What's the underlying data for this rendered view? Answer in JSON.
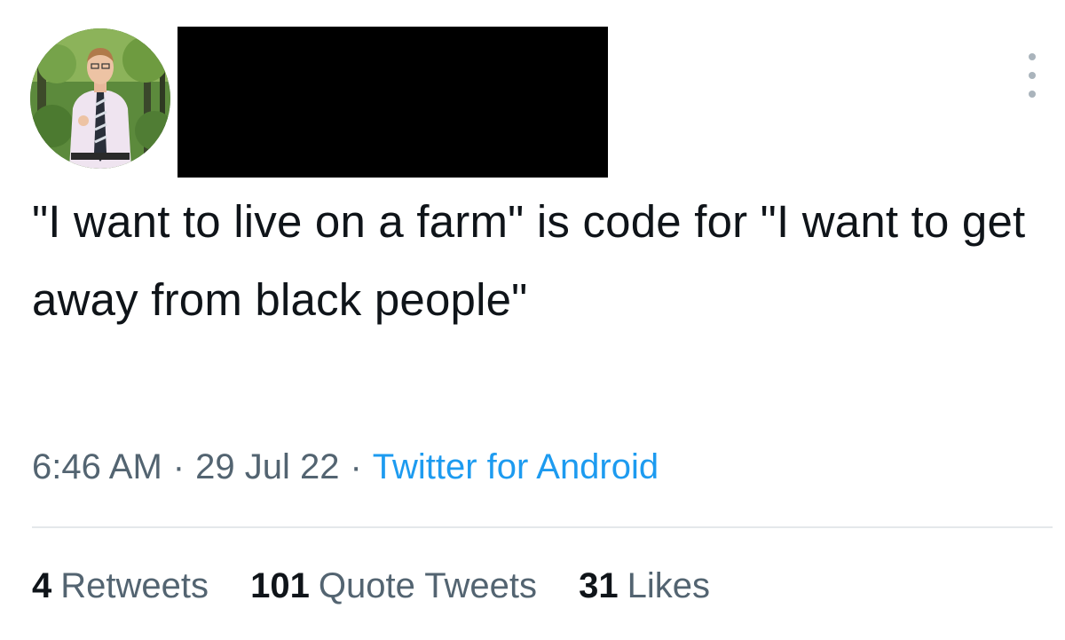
{
  "tweet": {
    "text": "\"I want to live on a farm\" is code for \"I want to get away from black people\"",
    "time": "6:46 AM",
    "date": "29 Jul 22",
    "separator": "·",
    "source": "Twitter for Android"
  },
  "stats": [
    {
      "count": "4",
      "label": "Retweets"
    },
    {
      "count": "101",
      "label": "Quote Tweets"
    },
    {
      "count": "31",
      "label": "Likes"
    }
  ],
  "colors": {
    "text": "#0f1419",
    "secondary": "#536471",
    "link": "#1d9bf0",
    "redaction": "#000000"
  },
  "icons": {
    "more": "more-vertical-icon"
  }
}
